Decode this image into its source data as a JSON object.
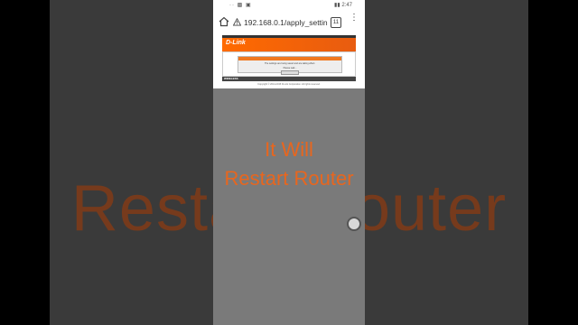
{
  "background": {
    "blur_caption": "Restart Router"
  },
  "status_bar": {
    "left_icons": "·· ▩ ▣",
    "right": "▮▮ 2:47"
  },
  "browser": {
    "url": "192.168.0.1/apply_settin",
    "tab_count": "11",
    "home_icon": "home-icon",
    "warning_icon": "not-secure-warning-icon",
    "menu_icon": "more-vert-icon"
  },
  "webpage": {
    "brand": "D-Link",
    "message_line1": "The settings are being saved and are taking effect.",
    "message_line2": "Please wait...",
    "footer_label": "WIRELESS",
    "copyright": "Copyright © 2014-2015 D-Link Corporation. All rights reserved."
  },
  "overlay": {
    "line1": "It Will",
    "line2": "Restart Router"
  },
  "colors": {
    "accent": "#e8661e",
    "dlink_orange": "#ff6a00"
  }
}
